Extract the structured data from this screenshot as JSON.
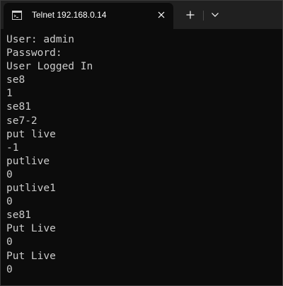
{
  "tab": {
    "icon": "terminal-icon",
    "title": "Telnet 192.168.0.14"
  },
  "controls": {
    "close_icon": "close-icon",
    "new_tab_icon": "plus-icon",
    "dropdown_icon": "chevron-down-icon"
  },
  "terminal": {
    "lines": [
      "User: admin",
      "Password:",
      "User Logged In",
      "se8",
      "1",
      "se81",
      "se7-2",
      "put live",
      "-1",
      "putlive",
      "0",
      "putlive1",
      "0",
      "se81",
      "Put Live",
      "0",
      "Put Live",
      "0"
    ]
  }
}
